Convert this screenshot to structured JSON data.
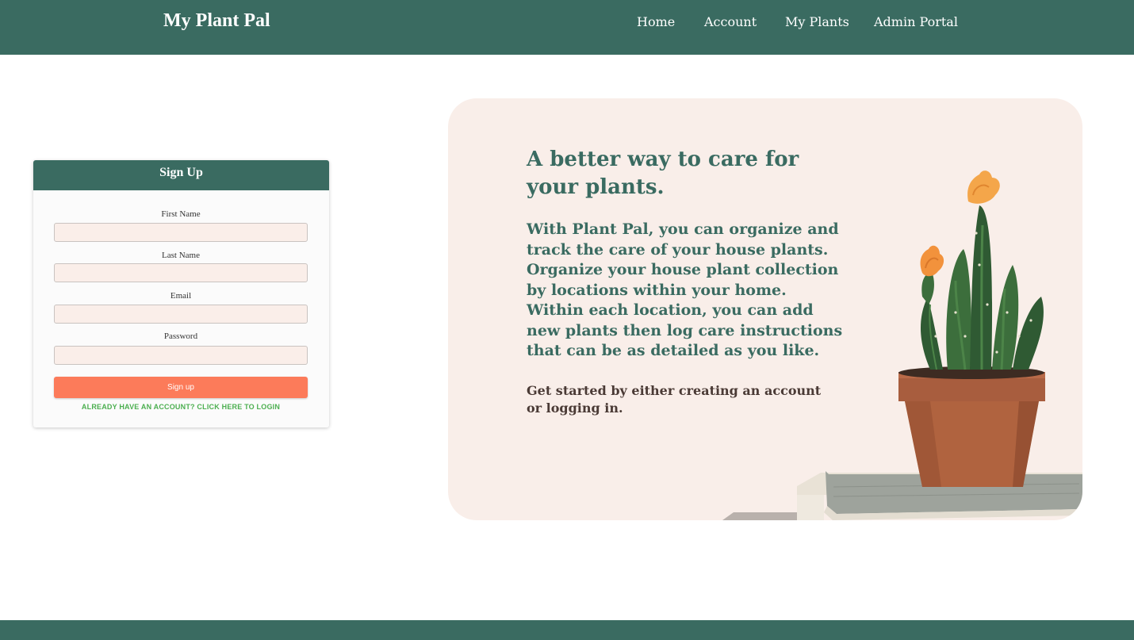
{
  "navbar": {
    "brand": "My Plant Pal",
    "links": [
      {
        "label": "Home"
      },
      {
        "label": "Account"
      },
      {
        "label": "My Plants"
      },
      {
        "label": "Admin Portal"
      }
    ]
  },
  "signup": {
    "title": "Sign Up",
    "fields": [
      {
        "label": "First Name",
        "value": "",
        "placeholder": ""
      },
      {
        "label": "Last Name",
        "value": "",
        "placeholder": ""
      },
      {
        "label": "Email",
        "value": "",
        "placeholder": ""
      },
      {
        "label": "Password",
        "value": "",
        "placeholder": ""
      }
    ],
    "submit_label": "Sign up",
    "login_link": "ALREADY HAVE AN ACCOUNT? CLICK HERE TO LOGIN"
  },
  "hero": {
    "headline": "A better way to care for your plants.",
    "body": "With Plant Pal, you can organize and track the care of your house plants. Organize your house plant collection by locations within your home. Within each location, you can add new plants then log care instructions that can be as detailed as you like.",
    "cta": "Get started by either creating an account or logging in.",
    "image_subject": "potted-cactus-on-books"
  },
  "colors": {
    "primary": "#3a6b61",
    "accent_button": "#fc7b5a",
    "link_green": "#4caf50",
    "hero_bg": "#f9eee9",
    "input_bg": "#faeee9"
  }
}
